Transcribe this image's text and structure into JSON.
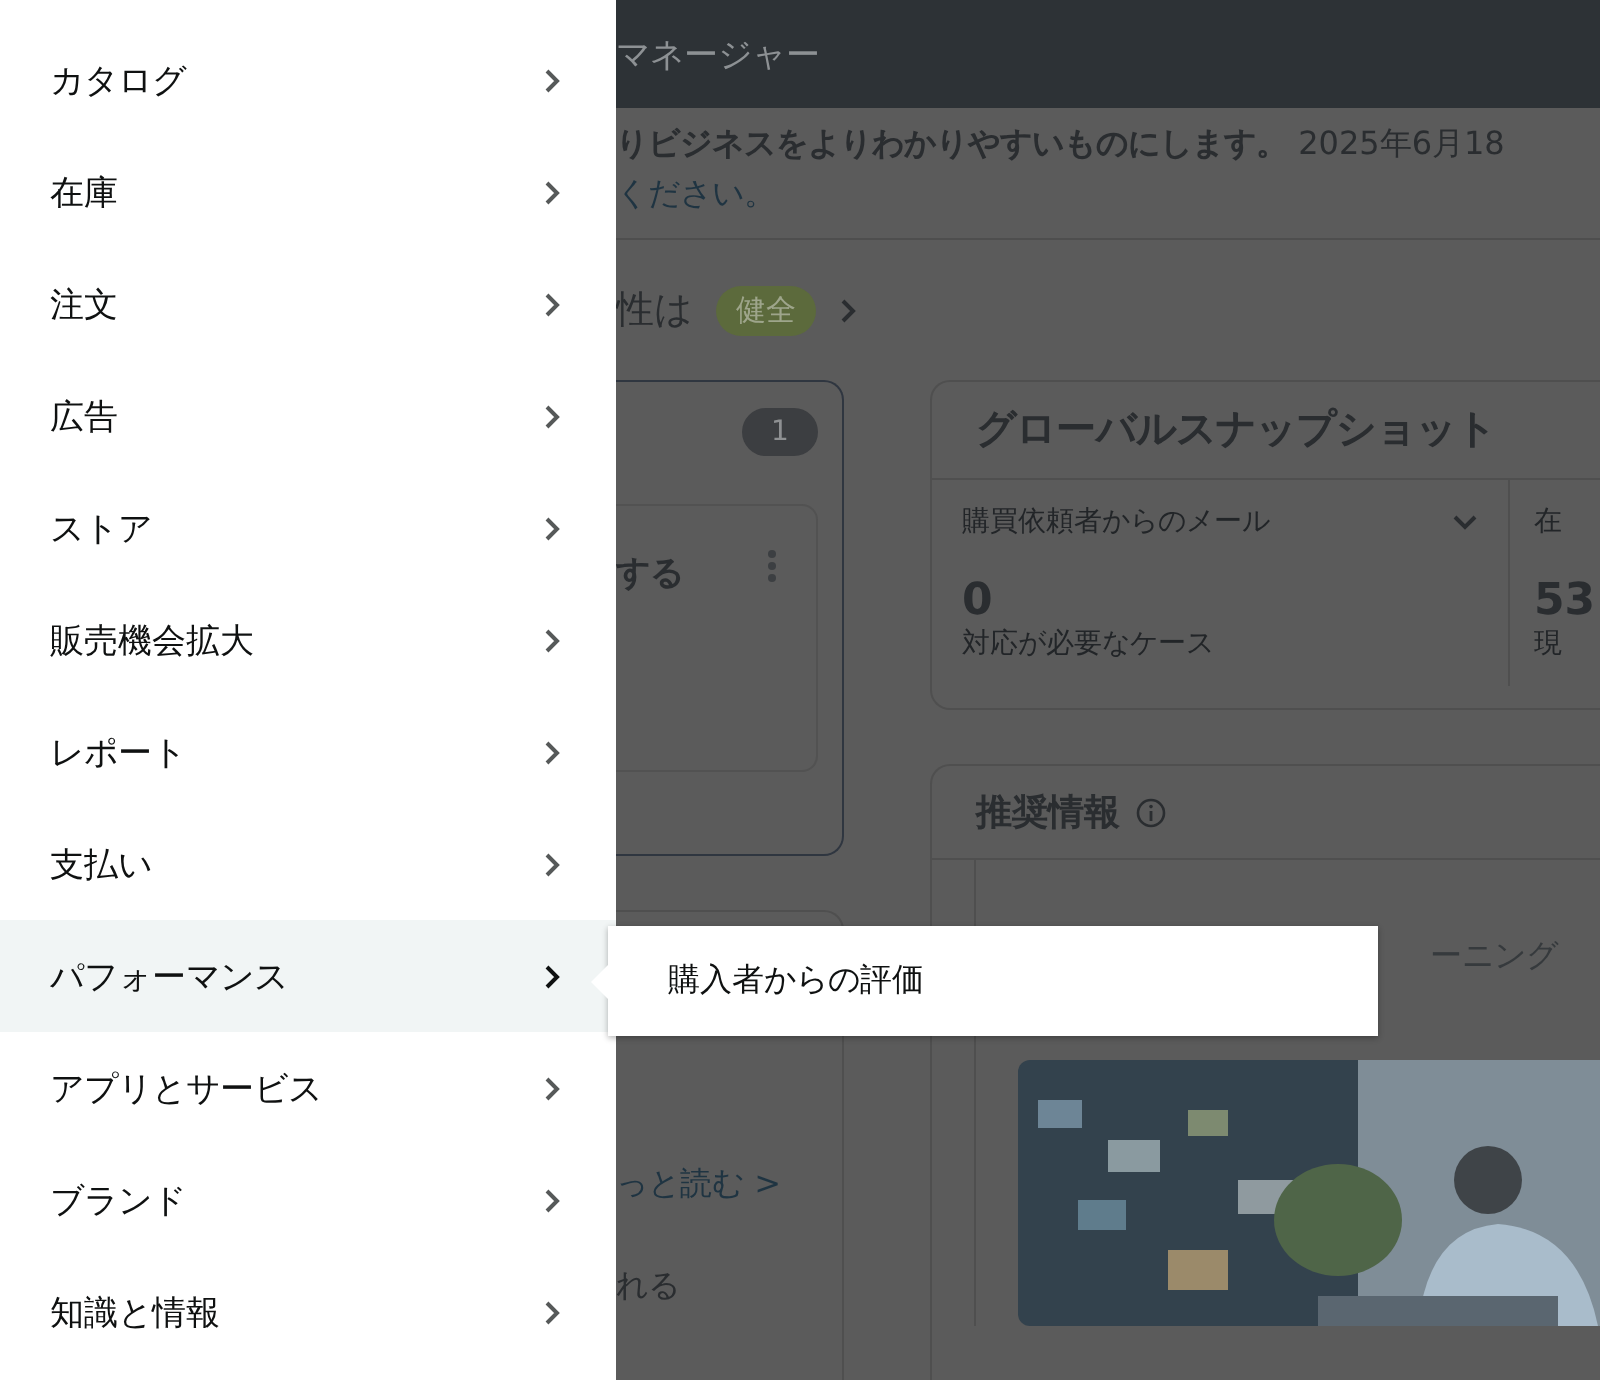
{
  "menu": {
    "items": [
      {
        "label": "カタログ",
        "selected": false
      },
      {
        "label": "在庫",
        "selected": false
      },
      {
        "label": "注文",
        "selected": false
      },
      {
        "label": "広告",
        "selected": false
      },
      {
        "label": "ストア",
        "selected": false
      },
      {
        "label": "販売機会拡大",
        "selected": false
      },
      {
        "label": "レポート",
        "selected": false
      },
      {
        "label": "支払い",
        "selected": false
      },
      {
        "label": "パフォーマンス",
        "selected": true
      },
      {
        "label": "アプリとサービス",
        "selected": false
      },
      {
        "label": "ブランド",
        "selected": false
      },
      {
        "label": "知識と情報",
        "selected": false
      }
    ]
  },
  "submenu": {
    "items": [
      "購入者からの評価"
    ]
  },
  "page": {
    "header_title": "マネージャー",
    "notice": {
      "headline": "りビジネスをよりわかりやすいものにします。",
      "date": "2025年6月18",
      "link": "ください。"
    },
    "health": {
      "label": "性は",
      "status": "健全"
    },
    "task_card": {
      "count": "1",
      "item_title": "する",
      "link": "っと読む >",
      "text": "れる"
    },
    "snapshot": {
      "title": "グローバルスナップショット",
      "tiles": [
        {
          "label": "購買依頼者からのメール",
          "value": "0",
          "caption": "対応が必要なケース"
        },
        {
          "label": "在",
          "value": "53",
          "caption": "現"
        }
      ]
    },
    "recommendations": {
      "title": "推奨情報",
      "item_title": "ーニング"
    }
  }
}
